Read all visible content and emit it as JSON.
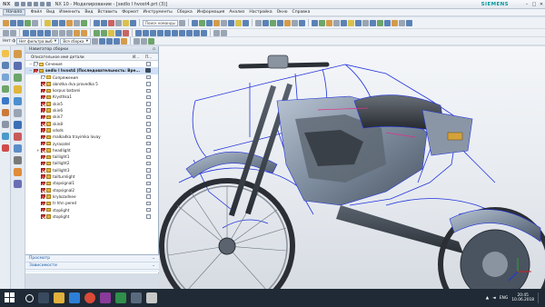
{
  "titlebar": {
    "logo": "NX",
    "title": "NX 10 - Моделирование - [sedlo l hvost4.prt  (3)]",
    "brand": "SIEMENS",
    "minimize": "–",
    "maximize": "□",
    "close": "✕"
  },
  "menubar": {
    "start_label": "Начало",
    "items": [
      "Файл",
      "Вид",
      "Изменить",
      "Вид",
      "Вставить",
      "Формат",
      "Инструменты",
      "Сборка",
      "Информация",
      "Анализ",
      "Настройка",
      "Окно",
      "Справка"
    ]
  },
  "toolbar": {
    "command_search_placeholder": "Поиск команды",
    "filter_label": "Нет ф",
    "filter_dropdown": "Нет фильтра выб",
    "assembly_dropdown": "Вся сборка"
  },
  "navigator": {
    "title": "Навигатор сборки",
    "col_name": "Описательное имя детали",
    "col_info": "И...",
    "col_check": "П...",
    "rows": [
      {
        "label": "Сечения",
        "indent": 1,
        "type": "folder",
        "checked": false
      },
      {
        "label": "sedlo l hvost4 (Последовательность: Вре...",
        "indent": 1,
        "type": "root",
        "checked": true
      },
      {
        "label": "Сопряжения",
        "indent": 2,
        "type": "folder",
        "checked": false
      },
      {
        "label": "obrotka dva provedka 5",
        "indent": 2,
        "type": "part",
        "checked": true
      },
      {
        "label": "korpus batarei",
        "indent": 2,
        "type": "part",
        "checked": true
      },
      {
        "label": "Krysthka1",
        "indent": 2,
        "type": "part",
        "checked": true
      },
      {
        "label": "skin5",
        "indent": 2,
        "type": "part",
        "checked": true
      },
      {
        "label": "skin6",
        "indent": 2,
        "type": "part",
        "checked": true
      },
      {
        "label": "skin7",
        "indent": 2,
        "type": "part",
        "checked": true
      },
      {
        "label": "skin8",
        "indent": 2,
        "type": "part",
        "checked": true
      },
      {
        "label": "sdsds",
        "indent": 2,
        "type": "part",
        "checked": true
      },
      {
        "label": "malkadka trayimka lovay",
        "indent": 2,
        "type": "part",
        "checked": true
      },
      {
        "label": "zyrasatel",
        "indent": 2,
        "type": "part",
        "checked": true
      },
      {
        "label": "headlight",
        "indent": 2,
        "type": "assembly",
        "checked": true
      },
      {
        "label": "taillight1",
        "indent": 2,
        "type": "part",
        "checked": true
      },
      {
        "label": "taillight2",
        "indent": 2,
        "type": "part",
        "checked": true
      },
      {
        "label": "taillight3",
        "indent": 2,
        "type": "part",
        "checked": true
      },
      {
        "label": "tailturnlight",
        "indent": 2,
        "type": "part",
        "checked": true
      },
      {
        "label": "stopsignal1",
        "indent": 2,
        "type": "part",
        "checked": true
      },
      {
        "label": "stopsignal2",
        "indent": 2,
        "type": "part",
        "checked": true
      },
      {
        "label": "krylozadnee",
        "indent": 2,
        "type": "part",
        "checked": true
      },
      {
        "label": "tr hhn pered",
        "indent": 2,
        "type": "part",
        "checked": true
      },
      {
        "label": "stoplight",
        "indent": 2,
        "type": "part",
        "checked": true
      },
      {
        "label": "stoplight",
        "indent": 2,
        "type": "part",
        "checked": true
      }
    ],
    "footer": [
      {
        "label": "Просмотр",
        "chev": "⌄"
      },
      {
        "label": "Зависимости",
        "chev": "⌄"
      }
    ]
  },
  "taskbar": {
    "search_icon": "search-icon",
    "time": "20:45",
    "date": "10.06.2018",
    "lang": "ENG"
  },
  "colors": {
    "wire_blue": "#2233dd",
    "body_gray": "#7e8d9f",
    "body_dark": "#3a4048",
    "accent_red": "#d43a3a",
    "siemens": "#009999"
  }
}
